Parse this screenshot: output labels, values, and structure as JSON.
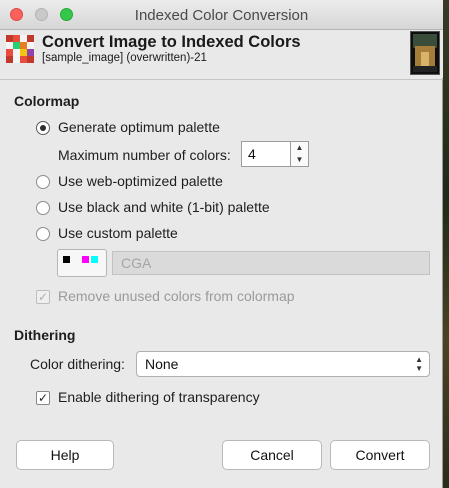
{
  "window": {
    "title": "Indexed Color Conversion"
  },
  "header": {
    "title": "Convert Image to Indexed Colors",
    "subtitle": "[sample_image] (overwritten)-21"
  },
  "colormap": {
    "section_title": "Colormap",
    "options": {
      "optimum": {
        "label": "Generate optimum palette",
        "selected": true
      },
      "web": {
        "label": "Use web-optimized palette",
        "selected": false
      },
      "bw": {
        "label": "Use black and white (1-bit) palette",
        "selected": false
      },
      "custom": {
        "label": "Use custom palette",
        "selected": false
      }
    },
    "max_colors": {
      "label": "Maximum number of colors:",
      "value": "4"
    },
    "custom_palette_name": "CGA",
    "remove_unused": {
      "label": "Remove unused colors from colormap",
      "checked": true,
      "enabled": false
    }
  },
  "dithering": {
    "section_title": "Dithering",
    "color_dithering": {
      "label": "Color dithering:",
      "value": "None"
    },
    "transparency": {
      "label": "Enable dithering of transparency",
      "checked": true
    }
  },
  "buttons": {
    "help": "Help",
    "cancel": "Cancel",
    "convert": "Convert"
  },
  "icons": {
    "header": "indexed-palette-icon",
    "swatch_colors": [
      "#000000",
      "#ff00ff",
      "#00ffff"
    ]
  }
}
